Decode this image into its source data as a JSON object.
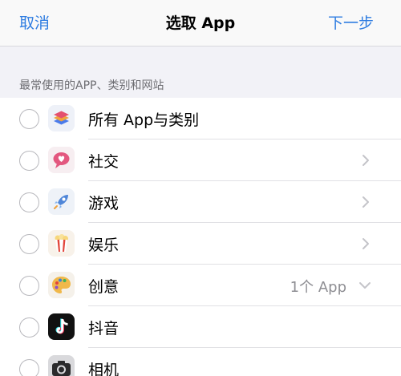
{
  "nav": {
    "cancel_label": "取消",
    "title": "选取 App",
    "next_label": "下一步"
  },
  "section": {
    "header": "最常使用的APP、类别和网站"
  },
  "rows": [
    {
      "label": "所有 App与类别",
      "icon": "all-apps-stack-icon",
      "accessory": "none"
    },
    {
      "label": "社交",
      "icon": "social-heart-bubble-icon",
      "accessory": "chevron"
    },
    {
      "label": "游戏",
      "icon": "games-rocket-icon",
      "accessory": "chevron"
    },
    {
      "label": "娱乐",
      "icon": "entertainment-popcorn-icon",
      "accessory": "chevron"
    },
    {
      "label": "创意",
      "icon": "creativity-palette-icon",
      "accessory": "chevron-down",
      "detail": "1个 App"
    },
    {
      "label": "抖音",
      "icon": "tiktok-icon",
      "accessory": "none"
    },
    {
      "label": "相机",
      "icon": "camera-icon",
      "accessory": "none"
    }
  ],
  "colors": {
    "accent": "#2f7de1",
    "background": "#f2f2f7",
    "secondary_text": "#8e8e93"
  }
}
